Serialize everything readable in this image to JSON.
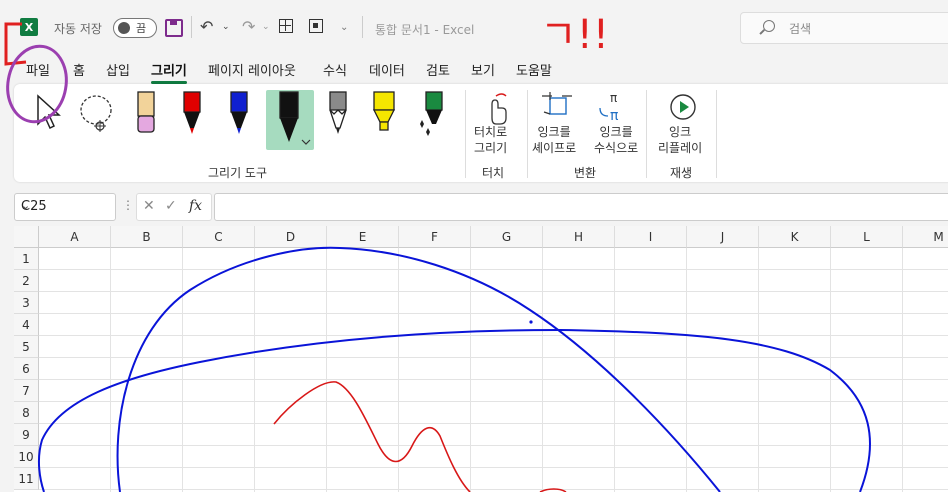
{
  "titlebar": {
    "autosave_label": "자동 저장",
    "autosave_state": "끔",
    "document_title": "통합 문서1  -  Excel",
    "search_placeholder": "검색",
    "app_logo": "X"
  },
  "tabs": [
    "파일",
    "홈",
    "삽입",
    "그리기",
    "페이지 레이아웃",
    "수식",
    "데이터",
    "검토",
    "보기",
    "도움말"
  ],
  "active_tab": "그리기",
  "ribbon": {
    "drawing_tools_label": "그리기 도구",
    "touch_button": "터치로\n그리기",
    "touch_group": "터치",
    "ink_to_shape": "잉크를\n셰이프로",
    "ink_to_math": "잉크를\n수식으로",
    "convert_group": "변환",
    "ink_replay": "잉크\n리플레이",
    "replay_group": "재생"
  },
  "pens": [
    {
      "name": "pencil",
      "color": "#e8a0d8"
    },
    {
      "name": "red-pen",
      "color": "#e00000"
    },
    {
      "name": "blue-pen",
      "color": "#1020d0"
    },
    {
      "name": "black-pen",
      "color": "#111111"
    },
    {
      "name": "gray-pencil",
      "color": "#888888"
    },
    {
      "name": "yellow-highlighter",
      "color": "#f5e600"
    },
    {
      "name": "green-effect-pen",
      "color": "#1a8a40"
    }
  ],
  "formula_bar": {
    "name_box": "C25",
    "cancel_glyph": "✕",
    "enter_glyph": "✓",
    "fx_label": "fx"
  },
  "columns": [
    "A",
    "B",
    "C",
    "D",
    "E",
    "F",
    "G",
    "H",
    "I",
    "J",
    "K",
    "L",
    "M"
  ],
  "rows": [
    "1",
    "2",
    "3",
    "4",
    "5",
    "6",
    "7",
    "8",
    "9",
    "10",
    "11"
  ],
  "annotations": {
    "top_text": "ㄱ!!",
    "annotation_color": "#e02020",
    "circle_color": "#9b3fb0"
  },
  "ink_colors": {
    "blue": "#0a14d8",
    "red": "#d81818"
  }
}
